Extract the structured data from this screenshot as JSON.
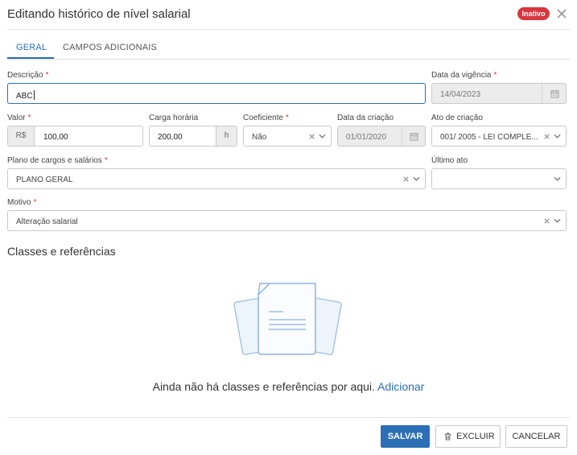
{
  "header": {
    "title": "Editando histórico de nível salarial",
    "status_badge": "Inativo"
  },
  "tabs": [
    {
      "label": "GERAL"
    },
    {
      "label": "CAMPOS ADICIONAIS"
    }
  ],
  "form": {
    "descricao": {
      "label": "Descrição",
      "value": "ABC"
    },
    "data_vigencia": {
      "label": "Data da vigência",
      "value": "14/04/2023"
    },
    "valor": {
      "label": "Valor",
      "prefix": "R$",
      "value": "100,00"
    },
    "carga_horaria": {
      "label": "Carga horária",
      "value": "200,00",
      "suffix": "h"
    },
    "coeficiente": {
      "label": "Coeficiente",
      "value": "Não"
    },
    "data_criacao": {
      "label": "Data da criação",
      "value": "01/01/2020"
    },
    "ato_criacao": {
      "label": "Ato de criação",
      "value": "001/ 2005 - LEI COMPLE..."
    },
    "plano": {
      "label": "Plano de cargos e salários",
      "value": "PLANO GERAL"
    },
    "ultimo_ato": {
      "label": "Último ato",
      "value": ""
    },
    "motivo": {
      "label": "Motivo",
      "value": "Alteração salarial"
    }
  },
  "classes": {
    "title": "Classes e referências",
    "empty_text": "Ainda não há classes e referências por aqui.",
    "add_link": "Adicionar"
  },
  "buttons": {
    "save": "SALVAR",
    "delete": "EXCLUIR",
    "cancel": "CANCELAR"
  },
  "colors": {
    "primary": "#2c6fb7",
    "danger": "#d9363e",
    "required": "#d9363e"
  },
  "icons": [
    "close-icon",
    "calendar-icon",
    "clear-icon",
    "chevron-down-icon",
    "trash-icon",
    "empty-document-icon"
  ]
}
